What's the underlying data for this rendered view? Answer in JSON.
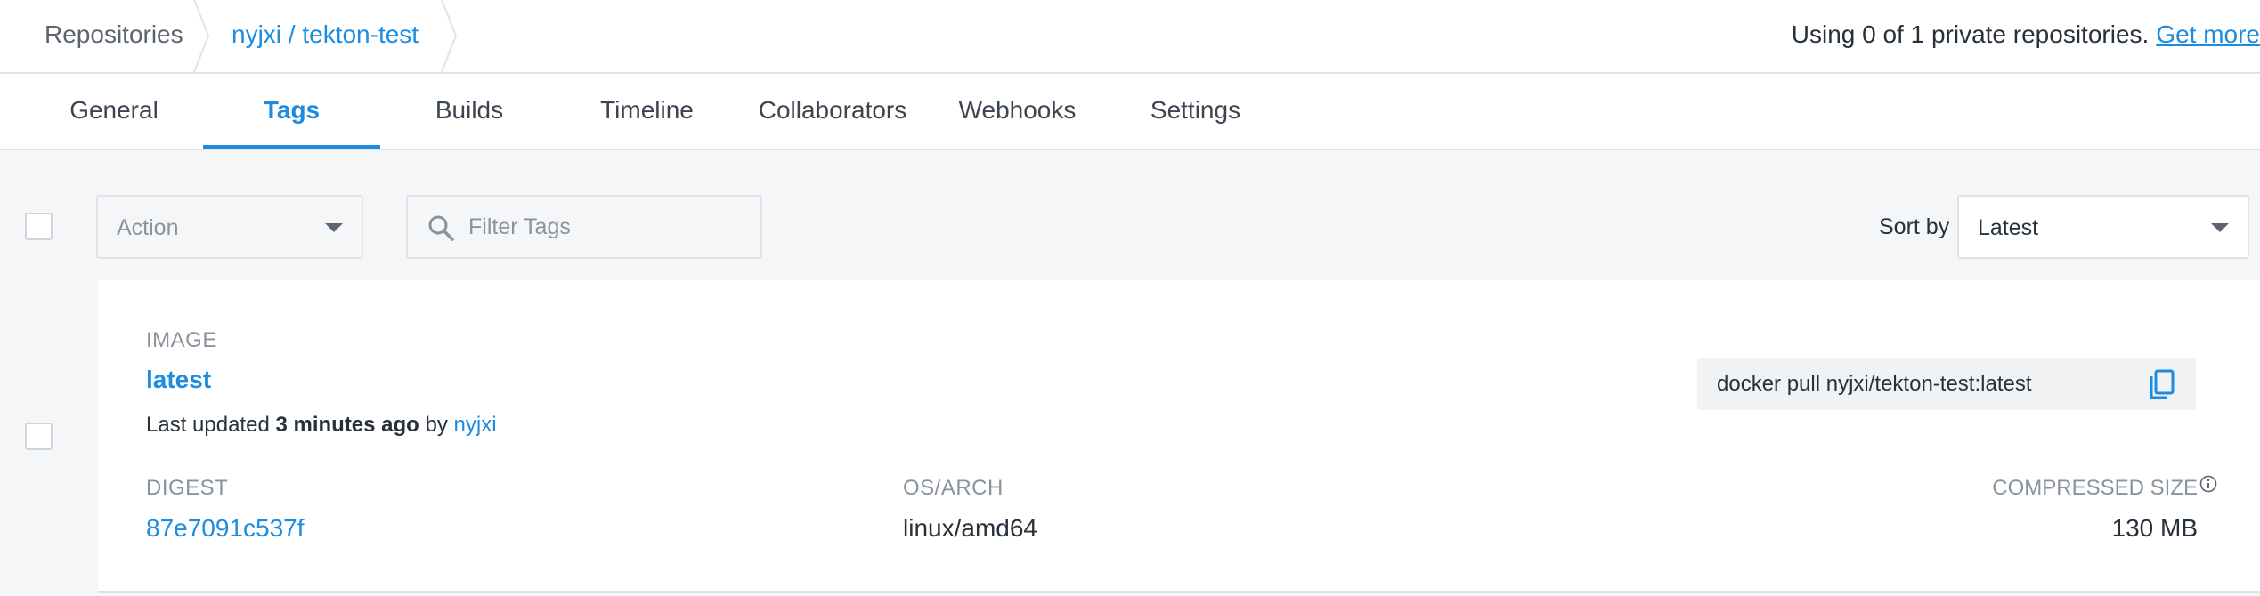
{
  "breadcrumb": {
    "repositories_label": "Repositories",
    "repo_label": "nyjxi / tekton-test"
  },
  "usage": {
    "text": "Using 0 of 1 private repositories.",
    "link": "Get more"
  },
  "tabs": [
    {
      "label": "General",
      "active": false
    },
    {
      "label": "Tags",
      "active": true
    },
    {
      "label": "Builds",
      "active": false
    },
    {
      "label": "Timeline",
      "active": false
    },
    {
      "label": "Collaborators",
      "active": false
    },
    {
      "label": "Webhooks",
      "active": false
    },
    {
      "label": "Settings",
      "active": false
    }
  ],
  "toolbar": {
    "action_placeholder": "Action",
    "filter_placeholder": "Filter Tags",
    "sort_label": "Sort by",
    "sort_value": "Latest"
  },
  "tag": {
    "image_label": "IMAGE",
    "name": "latest",
    "updated_prefix": "Last updated",
    "updated_time": "3 minutes ago",
    "updated_by_word": "by",
    "updated_user": "nyjxi",
    "pull_command": "docker pull nyjxi/tekton-test:latest",
    "digest_label": "DIGEST",
    "digest": "87e7091c537f",
    "osarch_label": "OS/ARCH",
    "osarch": "linux/amd64",
    "size_label": "COMPRESSED SIZE",
    "size": "130 MB"
  },
  "colors": {
    "accent": "#1d8ce0",
    "text": "#27313b",
    "muted": "#8a939c",
    "background": "#f5f6f8",
    "border": "#dfe3e8"
  },
  "icons": [
    "chevron-divider-icon",
    "caret-down-icon",
    "search-icon",
    "copy-icon",
    "info-icon"
  ]
}
